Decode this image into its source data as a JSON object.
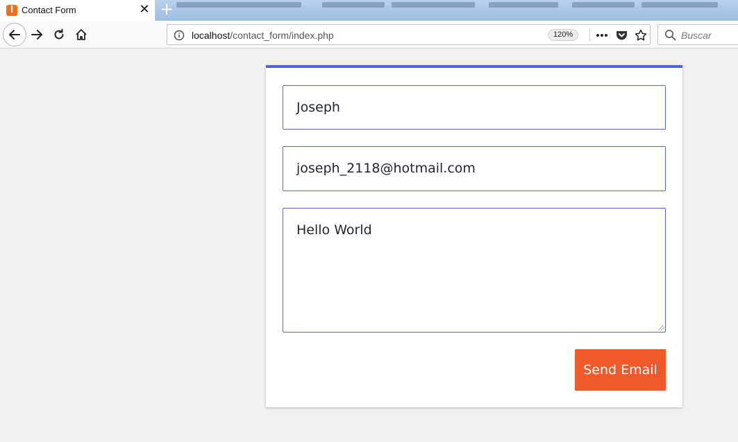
{
  "browser": {
    "tab": {
      "title": "Contact Form",
      "favicon": "xampp-icon",
      "close_icon": "close-icon"
    },
    "new_tab_icon": "plus-icon",
    "nav": {
      "back_icon": "arrow-left-icon",
      "forward_icon": "arrow-right-icon",
      "reload_icon": "reload-icon",
      "home_icon": "home-icon"
    },
    "address": {
      "host": "localhost",
      "path": "/contact_form/index.php",
      "zoom": "120%",
      "menu_icon": "more-icon",
      "pocket_icon": "pocket-icon",
      "bookmark_icon": "star-icon"
    },
    "search": {
      "placeholder": "Buscar",
      "icon": "search-icon"
    }
  },
  "form": {
    "name_value": "Joseph",
    "email_value": "joseph_2118@hotmail.com",
    "message_value": "Hello World",
    "submit_label": "Send Email"
  },
  "colors": {
    "accent": "#5260e6",
    "button": "#ef5a2b",
    "field_border": "#5a67d8",
    "page_bg": "#f1f1f1"
  }
}
